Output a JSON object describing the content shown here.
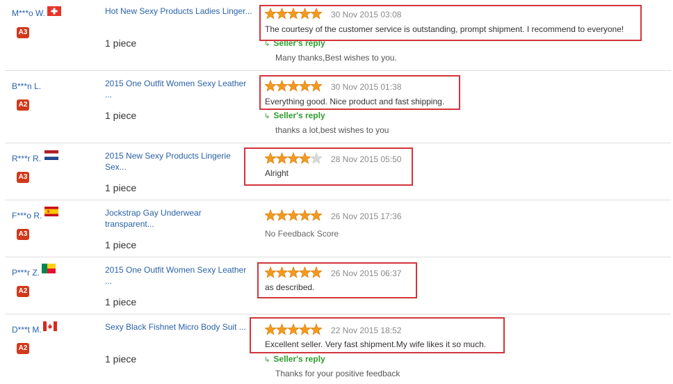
{
  "reviews": [
    {
      "buyer": "M***o W.",
      "flag": "flag-switzerland",
      "level": "A3",
      "product": "Hot New Sexy Products Ladies Linger...",
      "quantity": "1 piece",
      "rating": 5,
      "date": "30 Nov 2015 03:08",
      "comment": "The courtesy of the customer service is outstanding, prompt shipment. I recommend to everyone!",
      "reply_label": "Seller's reply",
      "reply_text": "Many thanks,Best wishes to you."
    },
    {
      "buyer": "B***n L.",
      "flag": "",
      "level": "A2",
      "product": "2015 One Outfit Women Sexy Leather ...",
      "quantity": "1 piece",
      "rating": 5,
      "date": "30 Nov 2015 01:38",
      "comment": "Everything good. Nice product and fast shipping.",
      "reply_label": "Seller's reply",
      "reply_text": "thanks a lot,best wishes to you"
    },
    {
      "buyer": "R***r R.",
      "flag": "flag-netherlands",
      "level": "A3",
      "product": "2015 New Sexy Products Lingerie Sex...",
      "quantity": "1 piece",
      "rating": 4,
      "date": "28 Nov 2015 05:50",
      "comment": "Alright"
    },
    {
      "buyer": "F***o R.",
      "flag": "flag-spain",
      "level": "A3",
      "product": "Jockstrap Gay Underwear transparent...",
      "quantity": "1 piece",
      "rating": 5,
      "date": "26 Nov 2015 17:36",
      "comment": "No Feedback Score"
    },
    {
      "buyer": "P***r Z.",
      "flag": "flag-benin",
      "level": "A2",
      "product": "2015 One Outfit Women Sexy Leather ...",
      "quantity": "1 piece",
      "rating": 5,
      "date": "26 Nov 2015 06:37",
      "comment": "as described."
    },
    {
      "buyer": "D***t M.",
      "flag": "flag-canada",
      "level": "A2",
      "product": "Sexy Black Fishnet Micro Body Suit ...",
      "quantity": "1 piece",
      "rating": 5,
      "date": "22 Nov 2015 18:52",
      "comment": "Excellent seller. Very fast shipment.My wife likes it so much.",
      "reply_label": "Seller's reply",
      "reply_text": "Thanks for your positive feedback"
    }
  ],
  "colors": {
    "link": "#2a62a8",
    "badge": "#d0391c",
    "star": "#f29a1f",
    "star_empty": "#d9d9d9",
    "reply": "#2e9c2e",
    "highlight": "#d2343a"
  }
}
